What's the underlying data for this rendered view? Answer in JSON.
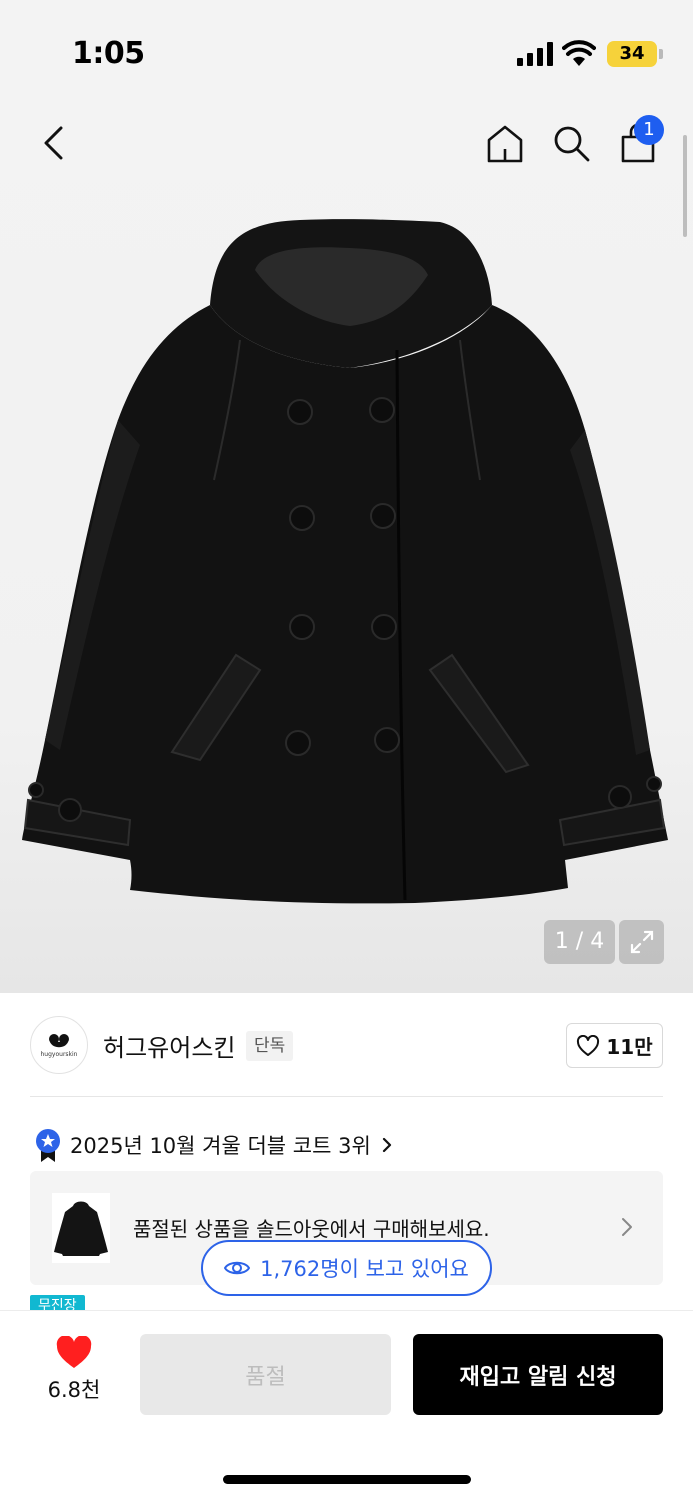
{
  "status_bar": {
    "time": "1:05",
    "battery": "34"
  },
  "header": {
    "cart_count": "1"
  },
  "gallery": {
    "page_counter": "1 / 4"
  },
  "brand": {
    "name": "허그유어스킨",
    "tag": "단독",
    "logo_text": "hugyourskin",
    "like_count": "11만"
  },
  "ranking": {
    "text": "2025년 10월 겨울 더블 코트 3위"
  },
  "soldout_card": {
    "text": "품절된 상품을 솔드아웃에서 구매해보세요."
  },
  "viewers": {
    "text": "1,762명이 보고 있어요"
  },
  "free_shipping_tag": "무진장",
  "bottom_bar": {
    "wish_count": "6.8천",
    "soldout_label": "품절",
    "restock_label": "재입고 알림 신청"
  },
  "colors": {
    "accent_blue": "#2d63e8",
    "badge_blue": "#1e5ef0",
    "heart_red": "#ff1f1f",
    "tag_cyan": "#11b8d1"
  }
}
